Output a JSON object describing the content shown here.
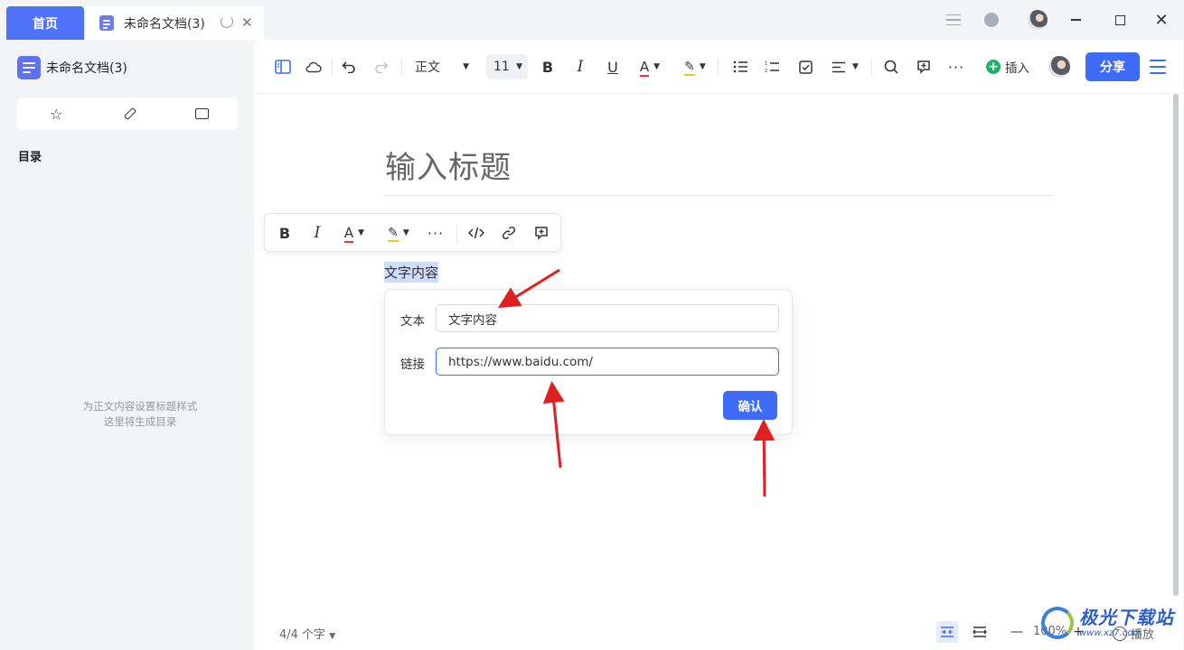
{
  "titlebar": {
    "home_tab": "首页",
    "doc_tab": "未命名文档(3)"
  },
  "sidebar": {
    "doc_title": "未命名文档(3)",
    "toc_label": "目录",
    "hint_line1": "为正文内容设置标题样式",
    "hint_line2": "这里将生成目录"
  },
  "toolbar": {
    "paragraph_style": "正文",
    "font_size": "11",
    "insert_label": "插入",
    "share_label": "分享"
  },
  "document": {
    "title_placeholder": "输入标题",
    "selected_text": "文字内容"
  },
  "link_dialog": {
    "text_label": "文本",
    "text_value": "文字内容",
    "link_label": "链接",
    "link_value": "https://www.baidu.com/",
    "confirm_label": "确认"
  },
  "statusbar": {
    "word_count": "4/4 个字",
    "zoom": "100%",
    "play_label": "播放"
  },
  "watermark": {
    "main": "极光下载站",
    "sub": "www.xz7.com"
  },
  "colors": {
    "accent": "#3e6bf7",
    "home_tab": "#4e73f8",
    "annotation_arrow": "#e02020",
    "selection": "#cfdcfa"
  },
  "icons": [
    "doc-icon",
    "refresh-icon",
    "close-icon",
    "menu-icon",
    "chat-icon",
    "avatar",
    "minimize-icon",
    "maximize-icon",
    "star-icon",
    "pen-icon",
    "folder-icon",
    "sidebar-toggle-icon",
    "cloud-icon",
    "undo-icon",
    "redo-icon",
    "bold-icon",
    "italic-icon",
    "underline-icon",
    "font-color-icon",
    "highlight-icon",
    "bullet-list-icon",
    "numbered-list-icon",
    "checkbox-icon",
    "align-icon",
    "search-icon",
    "comment-icon",
    "more-icon",
    "code-icon",
    "link-icon"
  ]
}
